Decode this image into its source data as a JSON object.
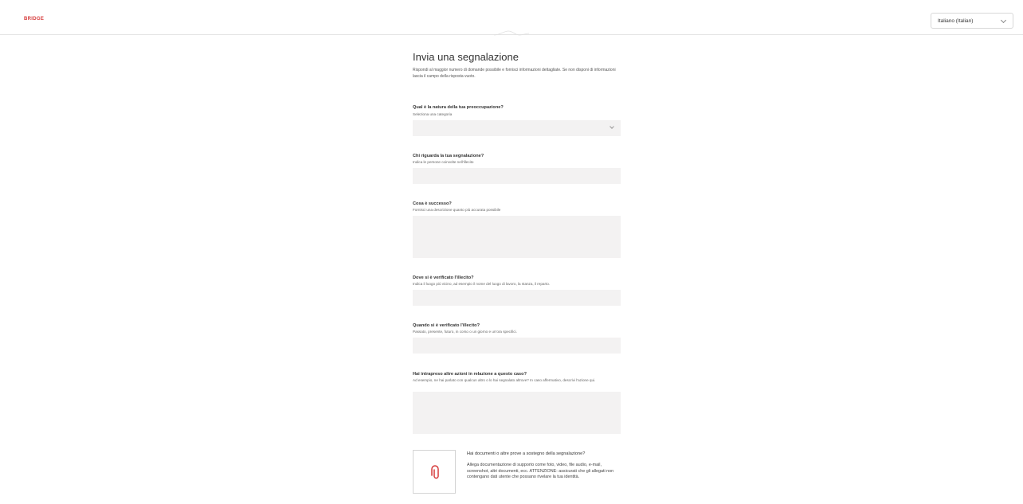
{
  "header": {
    "logo_text": "BRIDGE",
    "language_value": "Italiano (Italian)"
  },
  "form": {
    "title": "Invia una segnalazione",
    "intro": "Rispondi al maggior numero di domande possibile e fornisci informazioni dettagliate. Se non disponi di informazioni lascia il campo della risposta vuoto.",
    "questions": [
      {
        "label": "Qual è la natura della tua preoccupazione?",
        "help": "Seleziona una categoria"
      },
      {
        "label": "Chi riguarda la tua segnalazione?",
        "help": "Indica le persone coinvolte nell'illecito"
      },
      {
        "label": "Cosa è successo?",
        "help": "Fornisci una descrizione quanto più accurata possibile"
      },
      {
        "label": "Dove si è verificato l'illecito?",
        "help": "Indica il luogo più vicino, ad esempio il nome del luogo di lavoro, la stanza, il reparto."
      },
      {
        "label": "Quando si è verificato l'illecito?",
        "help": "Passato, presente, futuro, in corso o un giorno e un'ora specifici."
      },
      {
        "label": "Hai intrapreso altre azioni in relazione a questo caso?",
        "help": "Ad esempio, ne hai parlato con qualcun altro o lo hai segnalato altrove? In caso affermativo, descrivi l'azione qui."
      }
    ],
    "attachment": {
      "title": "Hai documenti o altre prove a sostegno della segnalazione?",
      "description": "Allega documentazione di supporto come foto, video, file audio, e-mail, screenshot, altri documenti, ecc. ATTENZIONE: assicurati che gli allegati non contengano dati utente che possano rivelare la tua identità."
    }
  },
  "colors": {
    "accent": "#d63a3a",
    "field_bg": "#f3f2f2",
    "text": "#333333"
  }
}
